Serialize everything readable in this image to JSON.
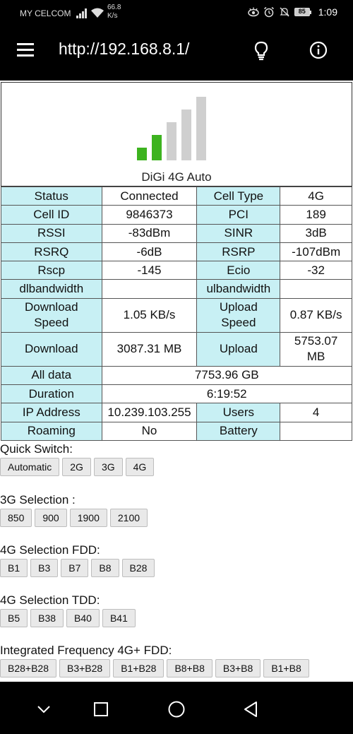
{
  "status_bar": {
    "carrier": "MY CELCOM",
    "net_speed_value": "66.8",
    "net_speed_unit": "K/s",
    "battery": "85",
    "time": "1:09"
  },
  "app_bar": {
    "url": "http://192.168.8.1/"
  },
  "signal": {
    "bars_total": 5,
    "bars_active": 2,
    "operator": "DiGi 4G Auto",
    "active_color": "#3db31f",
    "inactive_color": "#cfcfcf"
  },
  "table": {
    "status_label": "Status",
    "status_value": "Connected",
    "cell_type_label": "Cell Type",
    "cell_type_value": "4G",
    "cell_id_label": "Cell ID",
    "cell_id_value": "9846373",
    "pci_label": "PCI",
    "pci_value": "189",
    "rssi_label": "RSSI",
    "rssi_value": "-83dBm",
    "sinr_label": "SINR",
    "sinr_value": "3dB",
    "rsrq_label": "RSRQ",
    "rsrq_value": "-6dB",
    "rsrp_label": "RSRP",
    "rsrp_value": "-107dBm",
    "rscp_label": "Rscp",
    "rscp_value": "-145",
    "ecio_label": "Ecio",
    "ecio_value": "-32",
    "dlbw_label": "dlbandwidth",
    "dlbw_value": "",
    "ulbw_label": "ulbandwidth",
    "ulbw_value": "",
    "dl_speed_label_1": "Download",
    "dl_speed_label_2": "Speed",
    "dl_speed_value": "1.05 KB/s",
    "ul_speed_label_1": "Upload",
    "ul_speed_label_2": "Speed",
    "ul_speed_value": "0.87 KB/s",
    "download_label": "Download",
    "download_value": "3087.31 MB",
    "upload_label": "Upload",
    "upload_value_1": "5753.07",
    "upload_value_2": "MB",
    "all_data_label": "All data",
    "all_data_value": "7753.96 GB",
    "duration_label": "Duration",
    "duration_value": "6:19:52",
    "ip_label": "IP Address",
    "ip_value": "10.239.103.255",
    "users_label": "Users",
    "users_value": "4",
    "roaming_label": "Roaming",
    "roaming_value": "No",
    "battery_label": "Battery",
    "battery_value": ""
  },
  "quick_switch": {
    "title": "Quick Switch:",
    "buttons": [
      "Automatic",
      "2G",
      "3G",
      "4G"
    ]
  },
  "sel_3g": {
    "title": "3G Selection :",
    "buttons": [
      "850",
      "900",
      "1900",
      "2100"
    ]
  },
  "sel_4g_fdd": {
    "title": "4G Selection FDD:",
    "buttons": [
      "B1",
      "B3",
      "B7",
      "B8",
      "B28"
    ]
  },
  "sel_4g_tdd": {
    "title": "4G Selection TDD:",
    "buttons": [
      "B5",
      "B38",
      "B40",
      "B41"
    ]
  },
  "integrated": {
    "title": "Integrated Frequency 4G+ FDD:",
    "buttons": [
      "B28+B28",
      "B3+B28",
      "B1+B28",
      "B8+B8",
      "B3+B8",
      "B1+B8"
    ]
  }
}
